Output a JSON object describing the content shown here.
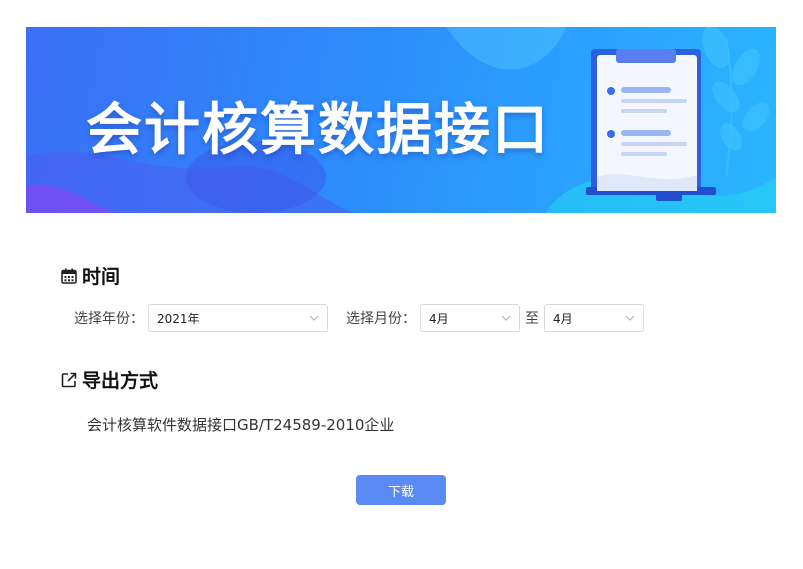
{
  "banner": {
    "title": "会计核算数据接口"
  },
  "time_section": {
    "title": "时间",
    "icon": "calendar-icon",
    "year_label": "选择年份：",
    "year_value": "2021年",
    "month_label": "选择月份：",
    "month_from": "4月",
    "to_label": "至",
    "month_to": "4月"
  },
  "export_section": {
    "title": "导出方式",
    "icon": "external-link-icon",
    "method": "会计核算软件数据接口GB/T24589-2010企业"
  },
  "actions": {
    "download_label": "下载"
  },
  "colors": {
    "primary_button": "#5a8bf4",
    "banner_start": "#3b6ff5",
    "banner_end": "#2ab6ff"
  }
}
